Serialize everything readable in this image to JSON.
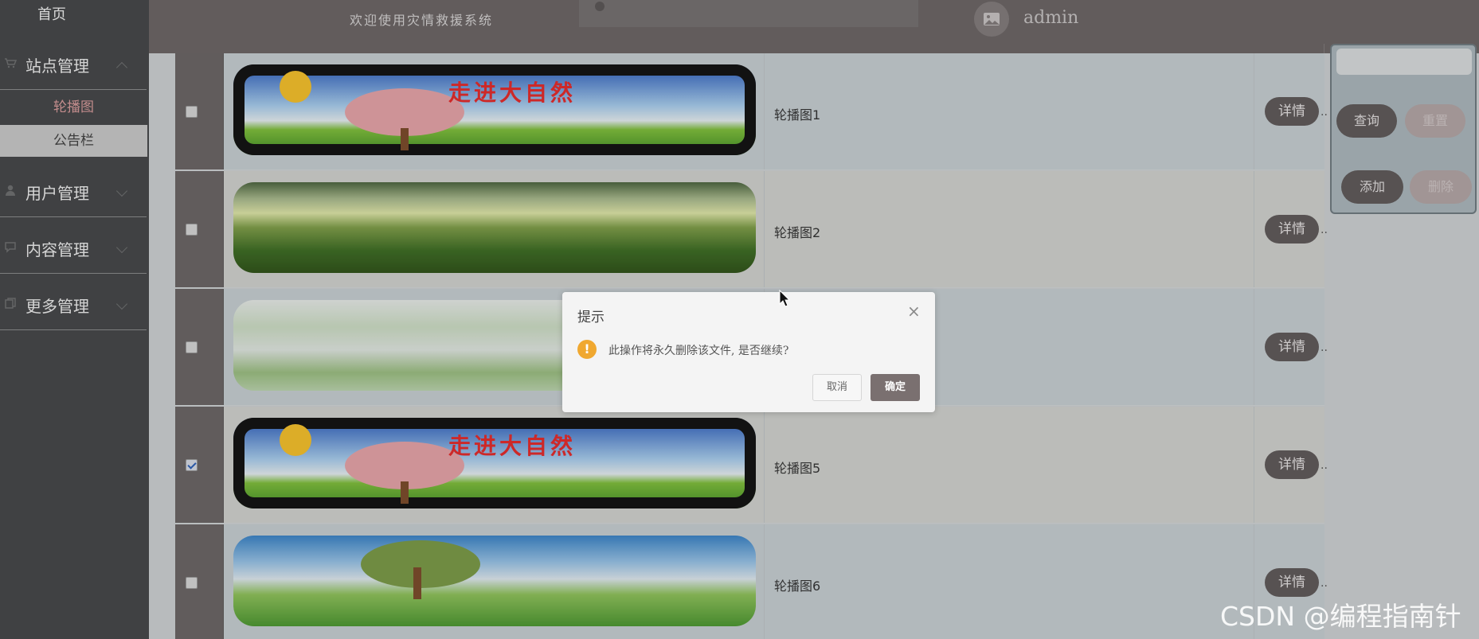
{
  "sidebar": {
    "home": "首页",
    "groups": [
      {
        "label": "站点管理",
        "icon": "cart-icon"
      },
      {
        "label": "用户管理",
        "icon": "user-icon"
      },
      {
        "label": "内容管理",
        "icon": "comment-icon"
      },
      {
        "label": "更多管理",
        "icon": "copy-icon"
      }
    ],
    "sub_items": [
      {
        "label": "轮播图",
        "active": true
      },
      {
        "label": "公告栏",
        "active": false
      }
    ]
  },
  "header": {
    "welcome": "欢迎使用灾情救援系统",
    "username": "admin"
  },
  "table": {
    "rows": [
      {
        "name": "轮播图1",
        "checked": false,
        "image": "走进大自然"
      },
      {
        "name": "轮播图2",
        "checked": false,
        "image": ""
      },
      {
        "name": "",
        "checked": false,
        "image": ""
      },
      {
        "name": "轮播图5",
        "checked": true,
        "image": "走进大自然"
      },
      {
        "name": "轮播图6",
        "checked": false,
        "image": ""
      }
    ],
    "detail_label": "详情",
    "ellipsis": ".."
  },
  "right_panel": {
    "query": "查询",
    "reset": "重置",
    "add": "添加",
    "delete": "删除"
  },
  "dialog": {
    "title": "提示",
    "close": "×",
    "message": "此操作将永久删除该文件, 是否继续?",
    "cancel": "取消",
    "confirm": "确定"
  },
  "watermark": "CSDN @编程指南针",
  "colors": {
    "sidebar_bg": "#454648",
    "header_bg": "#6b6565",
    "active_sub": "#d99b9b",
    "button_dark": "#5f5959",
    "warning": "#f0a830"
  }
}
